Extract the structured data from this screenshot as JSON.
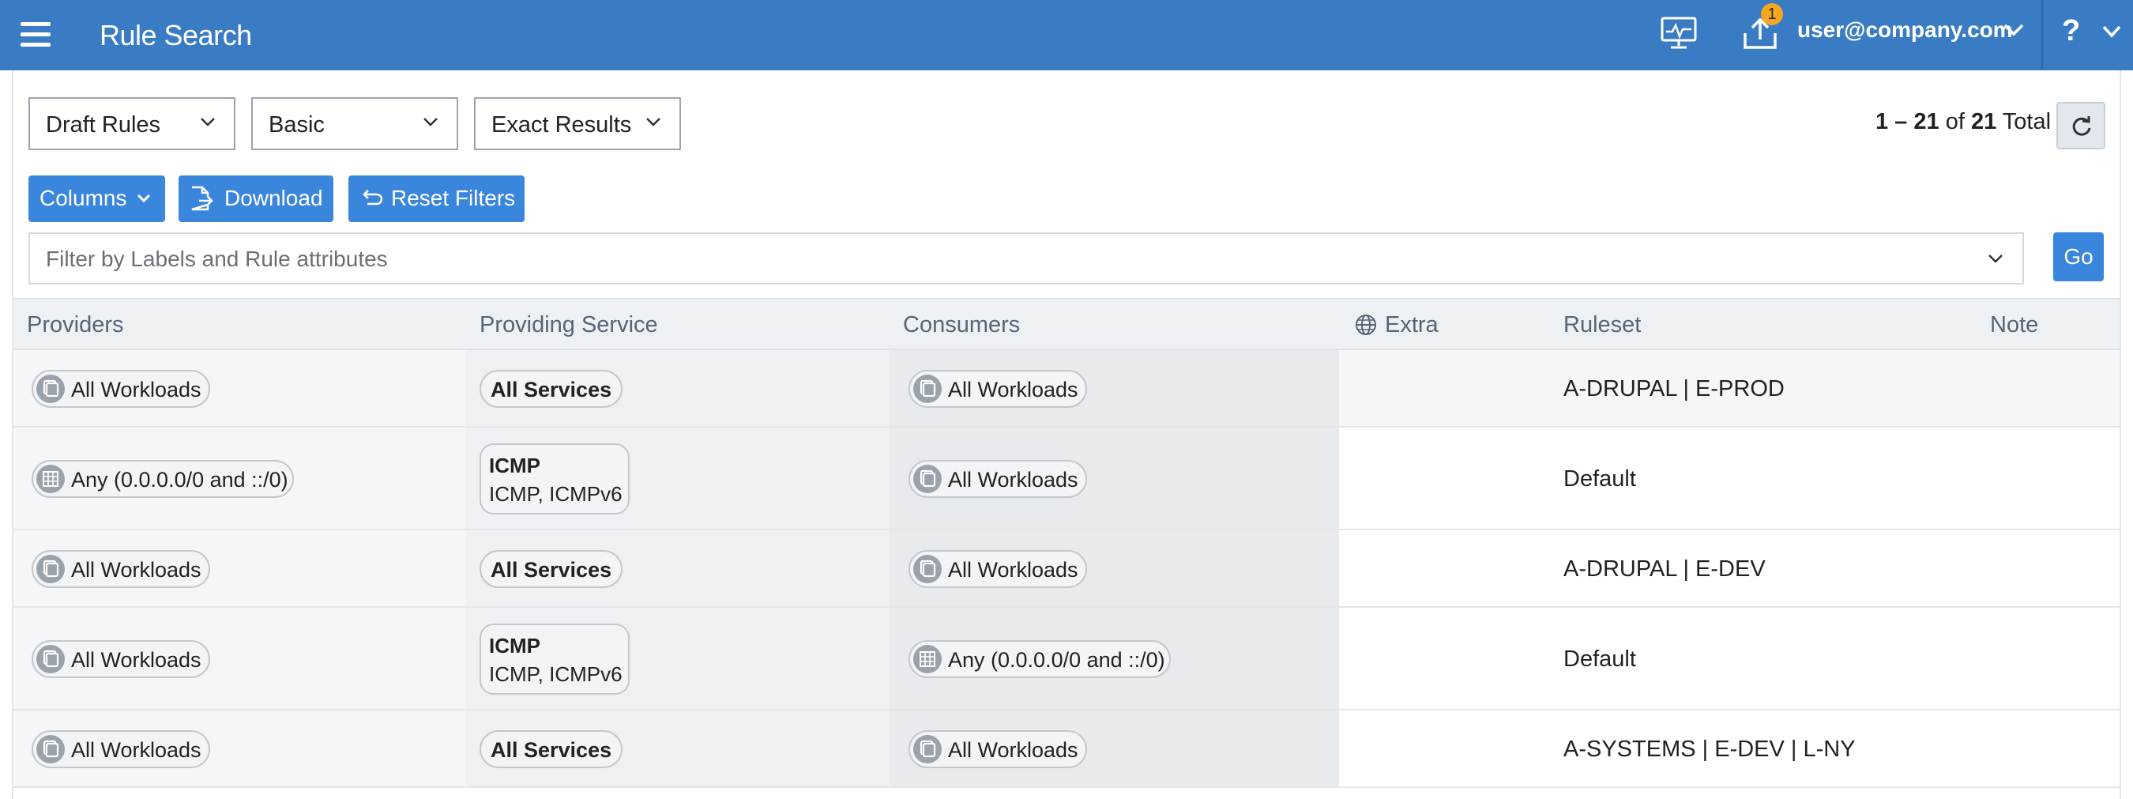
{
  "header": {
    "title": "Rule Search",
    "notification_count": "1",
    "user_email": "user@company.com",
    "help_label": "?"
  },
  "toolbar": {
    "selects": [
      {
        "value": "Draft Rules"
      },
      {
        "value": "Basic"
      },
      {
        "value": "Exact Results"
      }
    ],
    "result_range": "1 – 21",
    "result_of": "of",
    "result_total": "21",
    "result_total_label": "Total",
    "columns_label": "Columns",
    "download_label": "Download",
    "reset_label": "Reset Filters",
    "filter_placeholder": "Filter by Labels and Rule attributes",
    "go_label": "Go"
  },
  "table": {
    "columns": [
      "Providers",
      "Providing Service",
      "Consumers",
      "Extra",
      "Ruleset",
      "Note"
    ],
    "rows": [
      {
        "provider": "All Workloads",
        "provider_type": "workload",
        "service_title": "All Services",
        "service_sub": "",
        "consumer": "All Workloads",
        "consumer_type": "workload",
        "ruleset": "A-DRUPAL | E-PROD"
      },
      {
        "provider": "Any (0.0.0.0/0 and ::/0)",
        "provider_type": "iplist",
        "service_title": "ICMP",
        "service_sub": "ICMP, ICMPv6",
        "consumer": "All Workloads",
        "consumer_type": "workload",
        "ruleset": "Default"
      },
      {
        "provider": "All Workloads",
        "provider_type": "workload",
        "service_title": "All Services",
        "service_sub": "",
        "consumer": "All Workloads",
        "consumer_type": "workload",
        "ruleset": "A-DRUPAL | E-DEV"
      },
      {
        "provider": "All Workloads",
        "provider_type": "workload",
        "service_title": "ICMP",
        "service_sub": "ICMP, ICMPv6",
        "consumer": "Any (0.0.0.0/0 and ::/0)",
        "consumer_type": "iplist",
        "ruleset": "Default"
      },
      {
        "provider": "All Workloads",
        "provider_type": "workload",
        "service_title": "All Services",
        "service_sub": "",
        "consumer": "All Workloads",
        "consumer_type": "workload",
        "ruleset": "A-SYSTEMS | E-DEV | L-NY"
      }
    ]
  },
  "colors": {
    "header_bg": "#3a7cc3",
    "button_bg": "#3a86dd",
    "badge": "#f5a623"
  }
}
